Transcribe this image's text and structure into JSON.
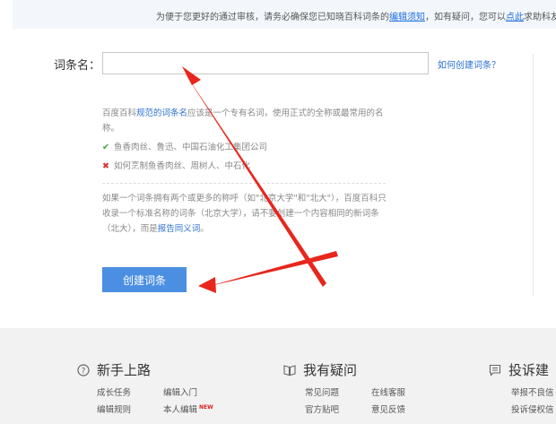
{
  "notice": {
    "prefix": "为便于您更好的通过审核，请务必确保您已知晓百科词条的",
    "link1": "编辑须知",
    "middle": "，如有疑问，您可以",
    "link2": "点此",
    "suffix": "求助科友"
  },
  "form": {
    "label": "词条名：",
    "input_value": "",
    "help_link": "如何创建词条？"
  },
  "guide": {
    "intro_prefix": "百度百科",
    "intro_link": "规范的词条名",
    "intro_suffix": "应该是一个专有名词，使用正式的全称或最常用的名称。",
    "good_example": "鱼香肉丝、鲁迅、中国石油化工集团公司",
    "bad_example": "如何烹制鱼香肉丝、周树人、中石化",
    "note_text": "如果一个词条拥有两个或更多的称呼（如\"北京大学\"和\"北大\"），百度百科只收录一个标准名称的词条（北京大学），请不要创建一个内容相同的新词条（北大），而是",
    "note_link": "报告同义词",
    "note_end": "。"
  },
  "create_button": "创建词条",
  "footer": {
    "sections": [
      {
        "title": "新手上路",
        "icon": "question-circle-icon",
        "links": [
          "成长任务",
          "编辑入门",
          "编辑规则",
          "本人编辑"
        ],
        "badge": "NEW"
      },
      {
        "title": "我有疑问",
        "icon": "book-icon",
        "links": [
          "常见问题",
          "在线客服",
          "官方贴吧",
          "意见反馈"
        ]
      },
      {
        "title": "投诉建",
        "icon": "message-icon",
        "links": [
          "举报不良信",
          "投诉侵权信"
        ]
      }
    ]
  },
  "colors": {
    "accent": "#4b8fe2",
    "link": "#2b6ed1",
    "annotation_arrow": "#e8261c"
  }
}
